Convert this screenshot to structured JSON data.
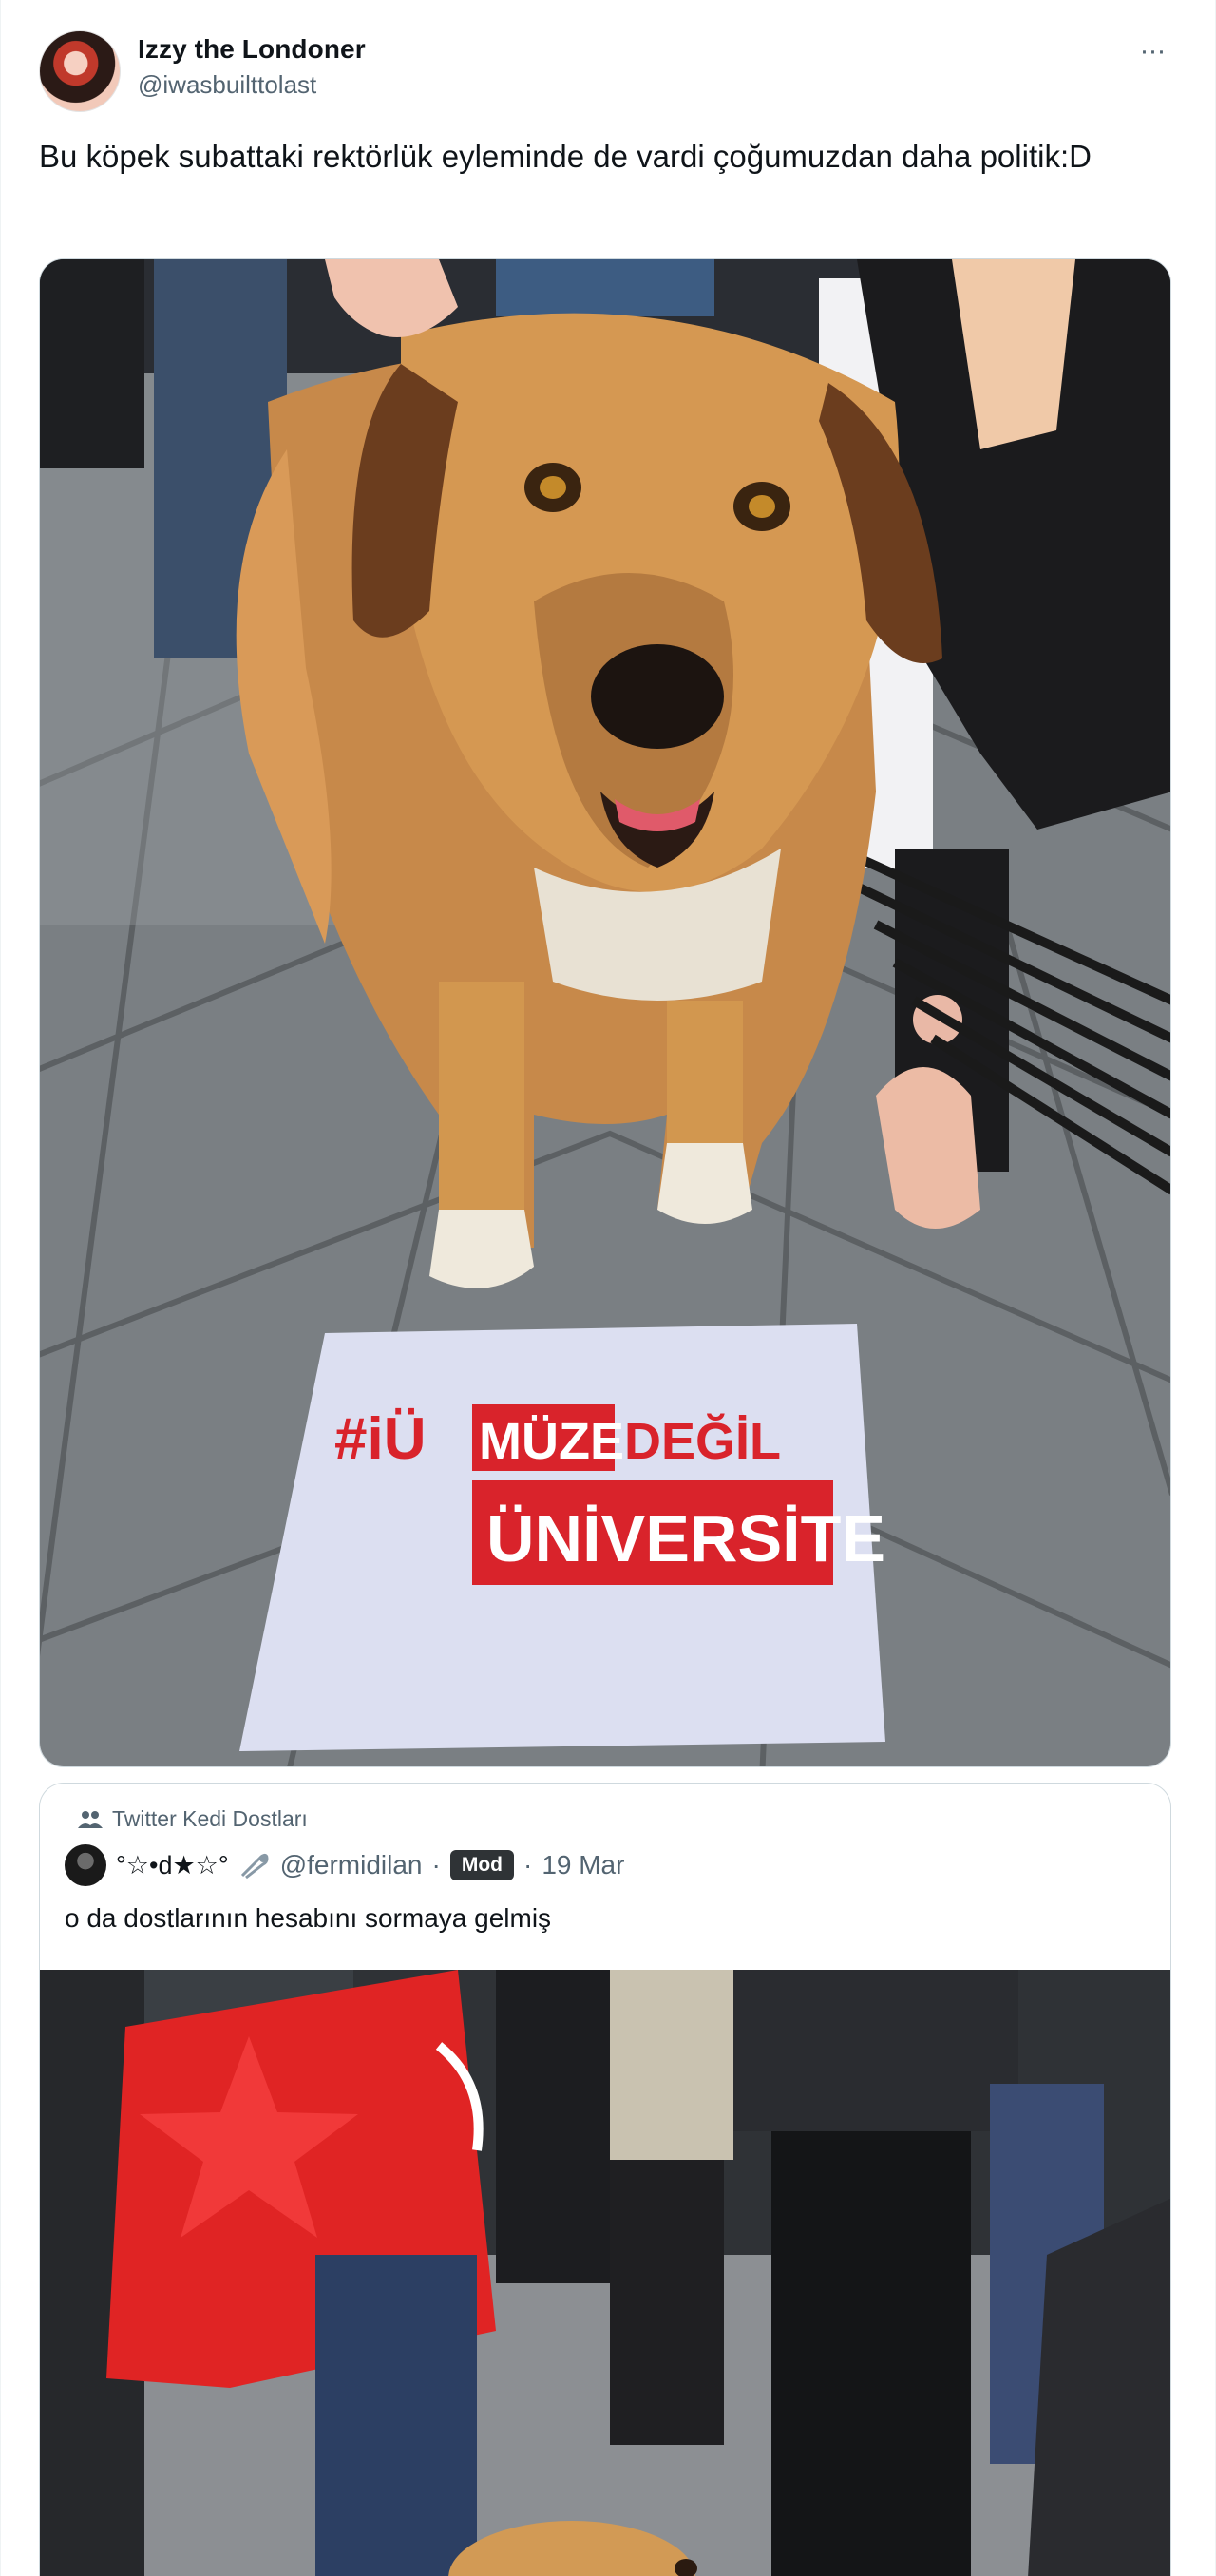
{
  "tweet": {
    "author": {
      "display_name": "Izzy the Londoner",
      "handle": "@iwasbuilttolast"
    },
    "more_label": "···",
    "text": "Bu köpek subattaki rektörlük eyleminde de vardi çoğumuzdan daha politik:D",
    "media": {
      "sign_line1_hashtag": "#iÜ",
      "sign_line1_word1": "MÜZE",
      "sign_line1_word2": "DEĞİL",
      "sign_line2": "ÜNİVERSİTE"
    }
  },
  "quoted_tweet": {
    "community": "Twitter Kedi Dostları",
    "author_name": "°☆•d★☆°",
    "handle": "@fermidilan",
    "separator": "·",
    "badge": "Mod",
    "date": "19 Mar",
    "text": "o da dostlarının hesabını sormaya gelmiş"
  },
  "colors": {
    "sign_red": "#d9232b",
    "handle_gray": "#536471",
    "border": "#cfd9de"
  }
}
